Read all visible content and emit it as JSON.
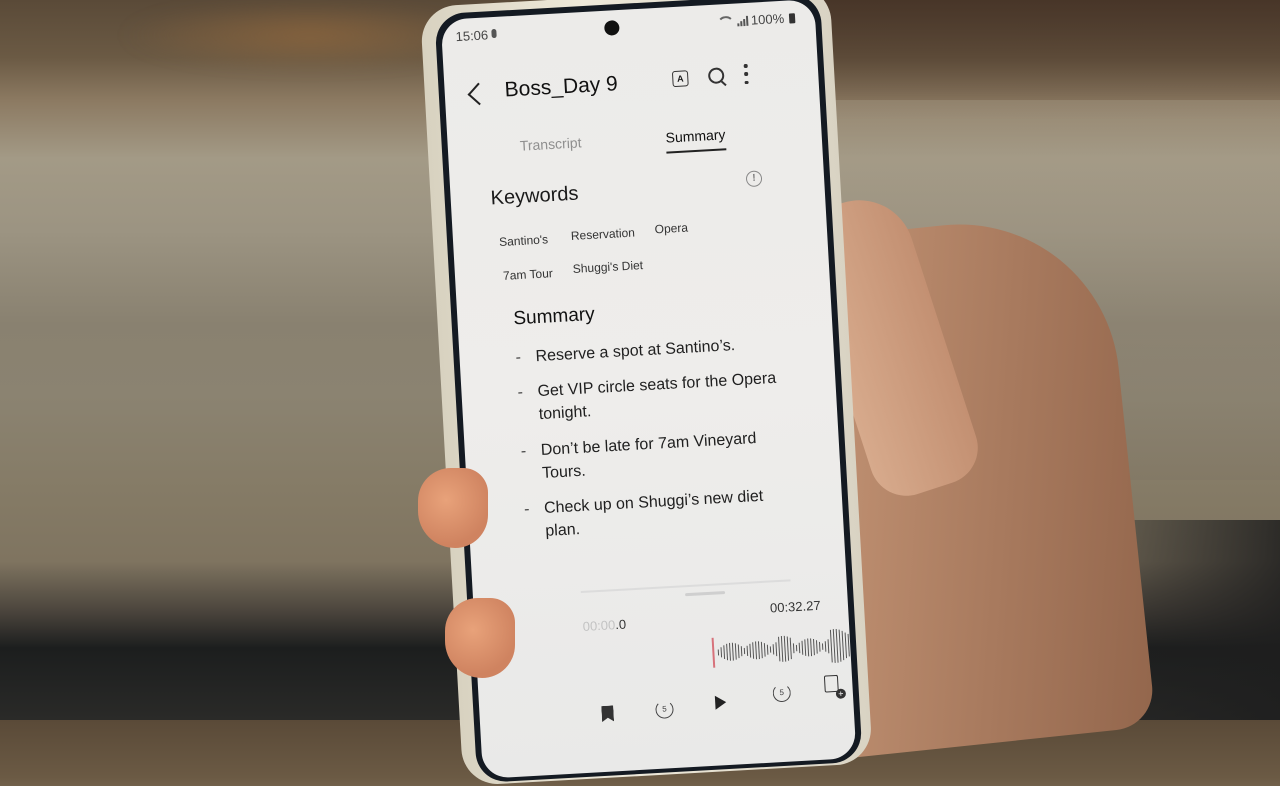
{
  "status_bar": {
    "time": "15:06",
    "battery": "100%"
  },
  "app_bar": {
    "title": "Boss_Day 9",
    "back_icon": "chevron-left-icon",
    "actions": [
      "translate-icon",
      "search-icon",
      "more-vertical-icon"
    ]
  },
  "tabs": [
    {
      "label": "Transcript",
      "active": false
    },
    {
      "label": "Summary",
      "active": true
    }
  ],
  "keywords": {
    "title": "Keywords",
    "info_icon": "info-icon",
    "items": [
      "Santino's",
      "Reservation",
      "Opera",
      "7am Tour",
      "Shuggi's Diet"
    ]
  },
  "summary": {
    "title": "Summary",
    "items": [
      "Reserve a spot at Santino’s.",
      "Get VIP circle seats for the Opera tonight.",
      "Don’t be late for 7am Vineyard Tours.",
      "Check up on Shuggi’s new diet plan."
    ]
  },
  "player": {
    "current_time_dim": "00:00",
    "current_time_em": ".0",
    "total_time": "00:32.27",
    "progress": 0,
    "playhead_color": "#d7727b",
    "controls": [
      "bookmark-icon",
      "rewind-5-icon",
      "play-icon",
      "forward-5-icon",
      "add-bookmark-icon"
    ],
    "rewind_label": "5",
    "forward_label": "5"
  }
}
